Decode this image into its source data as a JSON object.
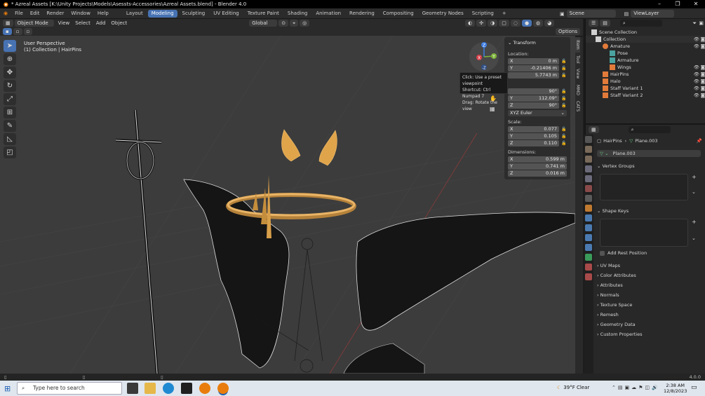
{
  "titlebar": {
    "title": "* Azreal Assets [K:\\Unity Projects\\Models\\Asessts-Accessories\\Azreal Assets.blend] - Blender 4.0"
  },
  "menu": {
    "items": [
      "File",
      "Edit",
      "Render",
      "Window",
      "Help"
    ],
    "workspaces": [
      "Layout",
      "Modeling",
      "Sculpting",
      "UV Editing",
      "Texture Paint",
      "Shading",
      "Animation",
      "Rendering",
      "Compositing",
      "Geometry Nodes",
      "Scripting"
    ],
    "active_workspace": "Modeling",
    "scene": "Scene",
    "view_layer": "ViewLayer"
  },
  "viewport_header": {
    "mode": "Object Mode",
    "view": "View",
    "select": "Select",
    "add": "Add",
    "object": "Object",
    "orientation": "Global",
    "options": "Options"
  },
  "viewport": {
    "perspective": "User Perspective",
    "collection_line": "(1) Collection | HairPins"
  },
  "gizmo": {
    "z": "Z",
    "y": "Y",
    "x": "X",
    "nz": "-Z"
  },
  "tooltip": {
    "line1": "Click: Use a preset viewpoint",
    "line2": "Shortcut: Ctrl Numpad 7",
    "line3": "Drag: Rotate the view"
  },
  "npanel": {
    "header": "Transform",
    "location_label": "Location:",
    "location": [
      {
        "axis": "X",
        "value": "0 m"
      },
      {
        "axis": "Y",
        "value": "-0.21406 m"
      },
      {
        "axis": "",
        "value": "5.7743 m"
      }
    ],
    "rotation": [
      {
        "axis": "",
        "value": "90°"
      },
      {
        "axis": "Y",
        "value": "112.09°"
      },
      {
        "axis": "Z",
        "value": "90°"
      }
    ],
    "rotation_mode": "XYZ Euler",
    "scale_label": "Scale:",
    "scale": [
      {
        "axis": "X",
        "value": "0.077"
      },
      {
        "axis": "Y",
        "value": "0.105"
      },
      {
        "axis": "Z",
        "value": "0.110"
      }
    ],
    "dimensions_label": "Dimensions:",
    "dimensions": [
      {
        "axis": "X",
        "value": "0.599 m"
      },
      {
        "axis": "Y",
        "value": "0.741 m"
      },
      {
        "axis": "Z",
        "value": "0.016 m"
      }
    ]
  },
  "sidetabs": [
    "Item",
    "Tool",
    "View",
    "MMD",
    "CATS"
  ],
  "outliner": {
    "items": [
      {
        "label": "Scene Collection",
        "depth": 0
      },
      {
        "label": "Collection",
        "depth": 1
      },
      {
        "label": "Amature",
        "depth": 2
      },
      {
        "label": "Pose",
        "depth": 3
      },
      {
        "label": "Armature",
        "depth": 3
      },
      {
        "label": "Wings",
        "depth": 3
      },
      {
        "label": "HairPins",
        "depth": 2
      },
      {
        "label": "Halo",
        "depth": 2
      },
      {
        "label": "Staff Variant 1",
        "depth": 2
      },
      {
        "label": "Staff Variant 2",
        "depth": 2
      }
    ]
  },
  "properties": {
    "breadcrumb_object": "HairPins",
    "breadcrumb_data": "Plane.003",
    "data_name": "Plane.003",
    "vertex_groups": "Vertex Groups",
    "shape_keys": "Shape Keys",
    "add_rest_position": "Add Rest Position",
    "sections": [
      "UV Maps",
      "Color Attributes",
      "Attributes",
      "Normals",
      "Texture Space",
      "Remesh",
      "Geometry Data",
      "Custom Properties"
    ]
  },
  "statusbar": {
    "version": "4.0.0"
  },
  "taskbar": {
    "search_placeholder": "Type here to search",
    "weather": "39°F  Clear",
    "time": "2:38 AM",
    "date": "12/8/2023"
  },
  "colors": {
    "accent": "#4772b3",
    "viewport_bg": "#3c3c3c",
    "gold": "#e0a44a"
  }
}
